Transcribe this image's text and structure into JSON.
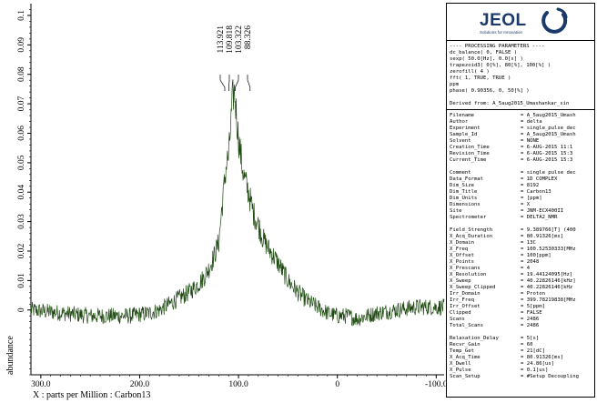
{
  "chart_data": {
    "type": "line",
    "title": "",
    "xlabel": "X : parts per Million : Carbon13",
    "ylabel": "abundance",
    "xlim": [
      310,
      -108
    ],
    "ylim": [
      -0.022,
      0.104
    ],
    "x_reversed": true,
    "x_ticks": [
      300,
      200,
      100,
      0,
      -100
    ],
    "x_tick_labels": [
      "300.0",
      "200.0",
      "100.0",
      "0",
      "-100.0"
    ],
    "y_ticks": [
      0,
      0.01,
      0.02,
      0.03,
      0.04,
      0.05,
      0.06,
      0.07,
      0.08,
      0.09,
      0.1
    ],
    "y_tick_labels": [
      "0",
      "0.01",
      "0.02",
      "0.03",
      "0.04",
      "0.05",
      "0.06",
      "0.07",
      "0.08",
      "0.09",
      "0.1"
    ],
    "grid": false,
    "line_color": "#1f4a12",
    "peak_labels": [
      {
        "label": "113.921",
        "x": 113.921
      },
      {
        "label": "109.818",
        "x": 109.818
      },
      {
        "label": "103.322",
        "x": 103.322
      },
      {
        "label": "88.326",
        "x": 88.326
      }
    ],
    "series": [
      {
        "x": [
          310,
          280,
          250,
          230,
          210,
          190,
          180,
          170,
          160,
          150,
          140,
          135,
          130,
          125,
          120,
          117,
          114,
          112,
          110,
          108,
          106,
          104,
          100,
          95,
          90,
          85,
          80,
          75,
          70,
          60,
          50,
          40,
          30,
          20,
          10,
          0,
          -10,
          -20,
          -40,
          -60,
          -80,
          -100,
          -108
        ],
        "y": [
          0.0,
          -0.001,
          -0.002,
          -0.002,
          -0.002,
          -0.001,
          0.0,
          0.002,
          0.004,
          0.006,
          0.009,
          0.011,
          0.014,
          0.018,
          0.023,
          0.034,
          0.044,
          0.05,
          0.052,
          0.062,
          0.072,
          0.074,
          0.058,
          0.046,
          0.04,
          0.033,
          0.029,
          0.024,
          0.021,
          0.016,
          0.01,
          0.006,
          0.003,
          0.001,
          -0.001,
          -0.002,
          -0.002,
          -0.003,
          -0.001,
          0.0,
          0.001,
          0.001,
          0.001
        ]
      }
    ]
  },
  "panel": {
    "logo_text": "JEOL",
    "logo_tagline": "Solutions for Innovation",
    "processing_lines": [
      "---- PROCESSING PARAMETERS ----",
      "dc_balance( 0, FALSE )",
      "sexp( 50.0[Hz], 0.0[s] )",
      "trapezoid3( 0[%], 80[%], 100[%] )",
      "zerofill( 4 )",
      "fft( 1, TRUE, TRUE )",
      "ppm",
      "phase( 0.90356, 0, 50[%] )",
      "",
      "Derived from: A_5aug2015_Umashankar_sin"
    ],
    "params": [
      {
        "k": "Filename",
        "v": "= A_5aug2015_Umash"
      },
      {
        "k": "Author",
        "v": "= delta"
      },
      {
        "k": "Experiment",
        "v": "= single_pulse_dec"
      },
      {
        "k": "Sample_Id",
        "v": "= A_5aug2015_Umash"
      },
      {
        "k": "Solvent",
        "v": "= NONE"
      },
      {
        "k": "Creation_Time",
        "v": "= 6-AUG-2015 11:1"
      },
      {
        "k": "Revision_Time",
        "v": "= 6-AUG-2015 15:3"
      },
      {
        "k": "Current_Time",
        "v": "= 6-AUG-2015 15:3"
      },
      {
        "k": "",
        "v": ""
      },
      {
        "k": "Comment",
        "v": "= single pulse dec"
      },
      {
        "k": "Data_Format",
        "v": "= 1D COMPLEX"
      },
      {
        "k": "Dim_Size",
        "v": "= 8192"
      },
      {
        "k": "Dim_Title",
        "v": "= Carbon13"
      },
      {
        "k": "Dim_Units",
        "v": "= [ppm]"
      },
      {
        "k": "Dimensions",
        "v": "= X"
      },
      {
        "k": "Site",
        "v": "= JNM-ECX400II"
      },
      {
        "k": "Spectrometer",
        "v": "= DELTA2_NMR"
      },
      {
        "k": "",
        "v": ""
      },
      {
        "k": "Field_Strength",
        "v": "= 9.389766[T] (400"
      },
      {
        "k": "X_Acq_Duration",
        "v": "= 80.91326[ms]"
      },
      {
        "k": "X_Domain",
        "v": "= 13C"
      },
      {
        "k": "X_Freq",
        "v": "= 100.52530333[MHz"
      },
      {
        "k": "X_Offset",
        "v": "= 100[ppm]"
      },
      {
        "k": "X_Points",
        "v": "= 2048"
      },
      {
        "k": "X_Prescans",
        "v": "= 4"
      },
      {
        "k": "X_Resolution",
        "v": "= 19.44124095[Hz]"
      },
      {
        "k": "X_Sweep",
        "v": "= 40.22826146[kHz]"
      },
      {
        "k": "X_Sweep_Clipped",
        "v": "= 40.22826146[kHz"
      },
      {
        "k": "Irr_Domain",
        "v": "= Proton"
      },
      {
        "k": "Irr_Freq",
        "v": "= 399.78219838[MHz"
      },
      {
        "k": "Irr_Offset",
        "v": "= 5[ppm]"
      },
      {
        "k": "Clipped",
        "v": "= FALSE"
      },
      {
        "k": "Scans",
        "v": "= 2486"
      },
      {
        "k": "Total_Scans",
        "v": "= 2486"
      },
      {
        "k": "",
        "v": ""
      },
      {
        "k": "Relaxation_Delay",
        "v": "= 5[s]"
      },
      {
        "k": "Recvr_Gain",
        "v": "= 60"
      },
      {
        "k": "Temp_Get",
        "v": "= 21[dC]"
      },
      {
        "k": "X_Acq_Time",
        "v": "= 80.91326[ms]"
      },
      {
        "k": "X_Dwell",
        "v": "= 24.86[us]"
      },
      {
        "k": "X_Pulse",
        "v": "= 0.1[us]"
      },
      {
        "k": "Scan_Setup",
        "v": "= #Setup Decoupling"
      }
    ]
  }
}
